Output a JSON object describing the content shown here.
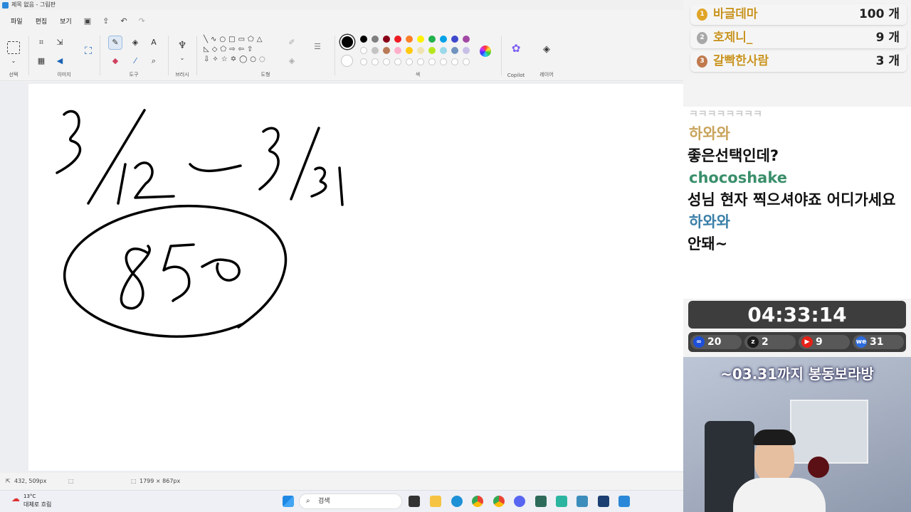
{
  "window": {
    "title": "제목 없음 - 그림판"
  },
  "menu": {
    "items": [
      "파일",
      "편집",
      "보기"
    ]
  },
  "ribbon": {
    "groups": {
      "select": "선택",
      "image": "이미지",
      "tools": "도구",
      "brush": "브러시",
      "shapes": "도형",
      "colors": "색",
      "copilot": "Copilot",
      "layers": "레이어"
    },
    "palette_row1": [
      "#000000",
      "#7f7f7f",
      "#880015",
      "#ed1c24",
      "#ff7f27",
      "#fff200",
      "#22b14c",
      "#00a2e8",
      "#3f48cc",
      "#a349a4"
    ],
    "palette_row2": [
      "#ffffff",
      "#c3c3c3",
      "#b97a57",
      "#ffaec9",
      "#ffc90e",
      "#efe4b0",
      "#b5e61d",
      "#99d9ea",
      "#7092be",
      "#c8bfe7"
    ],
    "current_color": "#000000"
  },
  "status": {
    "cursor": "432, 509px",
    "canvas_size": "1799 × 867px"
  },
  "taskbar": {
    "weather_temp": "13°C",
    "weather_desc": "대체로 흐림",
    "search_placeholder": "검색"
  },
  "overlay": {
    "donors": [
      {
        "rank": "1",
        "name": "바글데마",
        "count": "100 개",
        "medal_color": "#e0a526"
      },
      {
        "rank": "2",
        "name": "호제니_",
        "count": "9 개",
        "medal_color": "#a8a8a8"
      },
      {
        "rank": "3",
        "name": "갈빡한사람",
        "count": "3 개",
        "medal_color": "#c07a4e"
      }
    ],
    "chat": [
      {
        "name": "ㅋㅋㅋㅋㅋㅋㅋㅋ",
        "name_color": "#cccccc",
        "msg": ""
      },
      {
        "name": "하와와",
        "name_color": "#c9a45c",
        "msg": "좋은선택인데?"
      },
      {
        "name": "chocoshake",
        "name_color": "#3a8f6b",
        "msg": "성님 현자 찍으셔야죠 어디가세요"
      },
      {
        "name": "하와와",
        "name_color": "#3a7fa8",
        "msg": "안돼~"
      }
    ],
    "timer": "04:33:14",
    "platforms": [
      {
        "label": "20",
        "color": "#1d4fd8",
        "glyph": "∞"
      },
      {
        "label": "2",
        "color": "#1b1b1b",
        "glyph": "z"
      },
      {
        "label": "9",
        "color": "#e62117",
        "glyph": "▶"
      },
      {
        "label": "31",
        "color": "#2d6cdf",
        "glyph": "we"
      }
    ],
    "banner": "~03.31까지 봉동보라방"
  }
}
